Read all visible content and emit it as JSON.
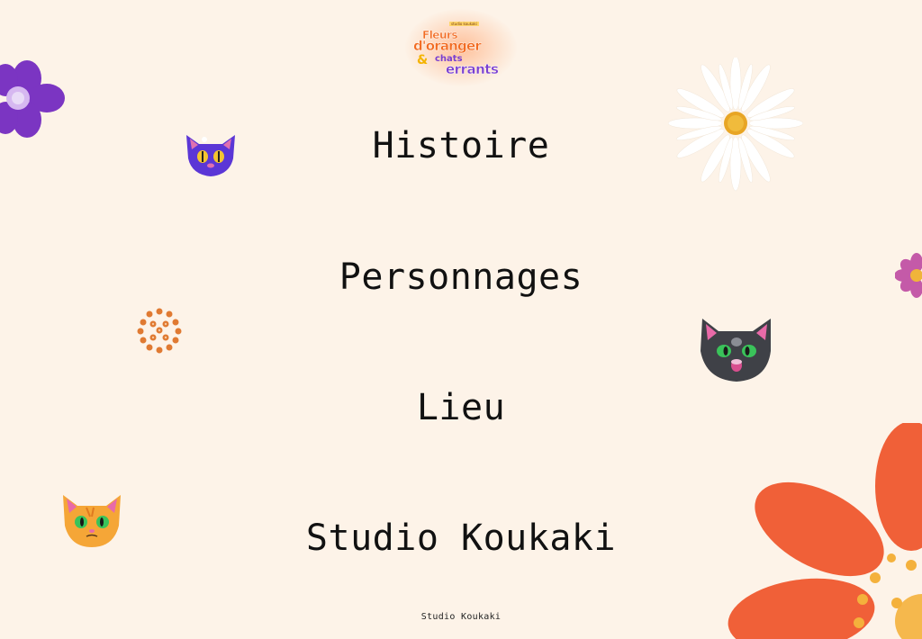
{
  "logo": {
    "badge_text": "studio koukaki",
    "line1": "Fleurs",
    "line2": "d'oranger",
    "ampersand": "&",
    "line3": "chats",
    "line4": "errants"
  },
  "menu": {
    "items": [
      {
        "label": "Histoire"
      },
      {
        "label": "Personnages"
      },
      {
        "label": "Lieu"
      },
      {
        "label": "Studio Koukaki"
      }
    ]
  },
  "footer": {
    "text": "Studio Koukaki"
  },
  "colors": {
    "background": "#fdf3e8",
    "text": "#111111",
    "accent_orange": "#f26b21",
    "accent_purple": "#7a3fd0"
  },
  "decorations": [
    "purple-flower-icon",
    "blue-cat-icon",
    "white-daisy-icon",
    "pink-flower-icon",
    "orange-flower-cluster-icon",
    "black-cat-icon",
    "orange-cat-icon",
    "large-orange-flower-icon"
  ]
}
